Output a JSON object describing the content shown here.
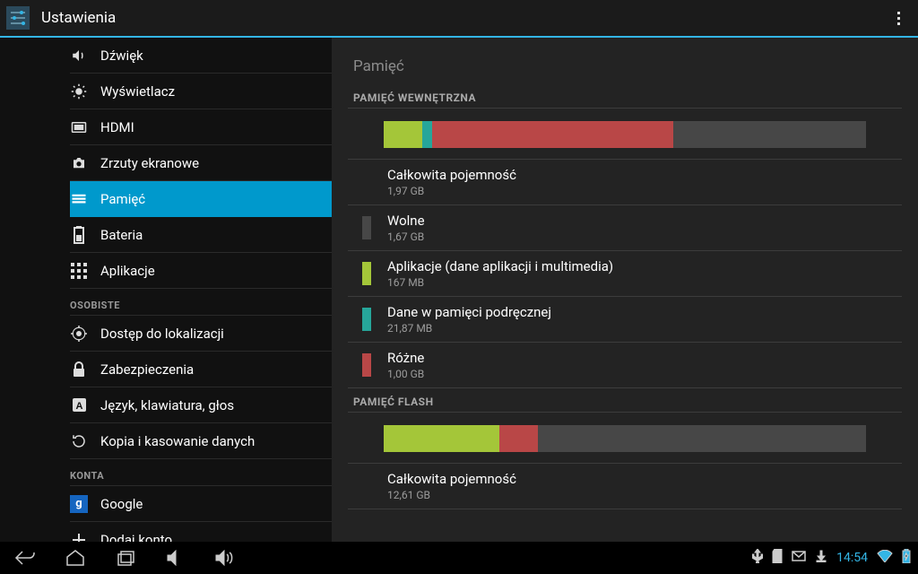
{
  "app": {
    "title": "Ustawienia"
  },
  "main_title": "Pamięć",
  "sidebar": {
    "items": [
      {
        "label": "Dźwięk",
        "icon": "sound-icon"
      },
      {
        "label": "Wyświetlacz",
        "icon": "display-icon"
      },
      {
        "label": "HDMI",
        "icon": "hdmi-icon"
      },
      {
        "label": "Zrzuty ekranowe",
        "icon": "camera-icon"
      },
      {
        "label": "Pamięć",
        "icon": "storage-icon"
      },
      {
        "label": "Bateria",
        "icon": "battery-icon"
      },
      {
        "label": "Aplikacje",
        "icon": "apps-icon"
      }
    ],
    "section_personal": "OSOBISTE",
    "items2": [
      {
        "label": "Dostęp do lokalizacji",
        "icon": "location-icon"
      },
      {
        "label": "Zabezpieczenia",
        "icon": "lock-icon"
      },
      {
        "label": "Język, klawiatura, głos",
        "icon": "language-icon"
      },
      {
        "label": "Kopia i kasowanie danych",
        "icon": "backup-icon"
      }
    ],
    "section_accounts": "KONTA",
    "items3": [
      {
        "label": "Google",
        "icon": "google-icon"
      },
      {
        "label": "Dodaj konto",
        "icon": "plus-icon"
      }
    ]
  },
  "storage": {
    "internal": {
      "header": "PAMIĘĆ WEWNĘTRZNA",
      "bar": {
        "apps_pct": 8,
        "cache_pct": 2,
        "misc_pct": 50
      },
      "rows": [
        {
          "title": "Całkowita pojemność",
          "sub": "1,97 GB",
          "color": "transparent"
        },
        {
          "title": "Wolne",
          "sub": "1,67 GB",
          "color": "#474747"
        },
        {
          "title": "Aplikacje (dane aplikacji i multimedia)",
          "sub": "167 MB",
          "color": "#a4c639"
        },
        {
          "title": "Dane w pamięci podręcznej",
          "sub": "21,87 MB",
          "color": "#26a69a"
        },
        {
          "title": "Różne",
          "sub": "1,00 GB",
          "color": "#b94747"
        }
      ]
    },
    "flash": {
      "header": "PAMIĘĆ FLASH",
      "bar": {
        "apps_pct": 24,
        "cache_pct": 0,
        "misc_pct": 8
      },
      "rows": [
        {
          "title": "Całkowita pojemność",
          "sub": "12,61 GB",
          "color": "transparent"
        }
      ]
    }
  },
  "statusbar": {
    "time": "14:54"
  }
}
